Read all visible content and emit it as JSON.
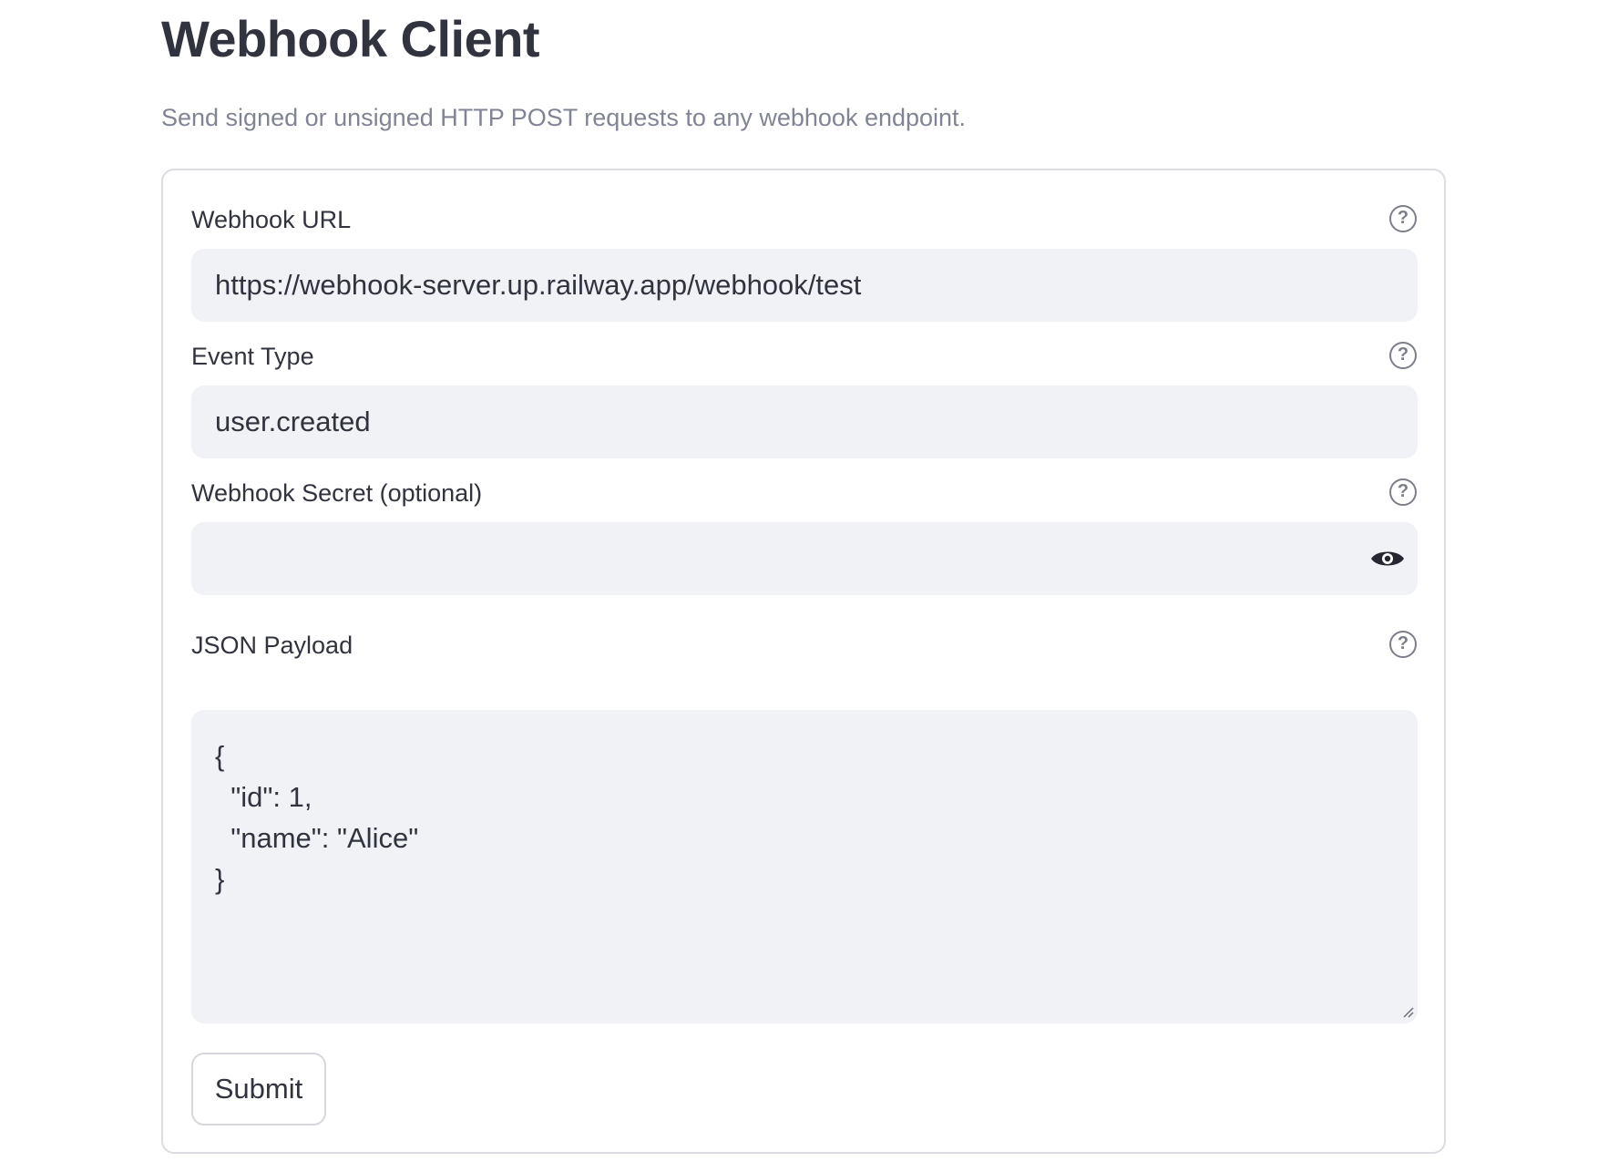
{
  "page": {
    "title": "Webhook Client",
    "subtitle": "Send signed or unsigned HTTP POST requests to any webhook endpoint."
  },
  "form": {
    "webhook_url": {
      "label": "Webhook URL",
      "value": "https://webhook-server.up.railway.app/webhook/test",
      "help_icon": "help-circle-icon"
    },
    "event_type": {
      "label": "Event Type",
      "value": "user.created",
      "help_icon": "help-circle-icon"
    },
    "webhook_secret": {
      "label": "Webhook Secret (optional)",
      "value": "",
      "help_icon": "help-circle-icon",
      "visibility_icon": "eye-icon"
    },
    "json_payload": {
      "label": "JSON Payload",
      "value": "{\n  \"id\": 1,\n  \"name\": \"Alice\"\n}",
      "help_icon": "help-circle-icon"
    },
    "submit_label": "Submit"
  },
  "colors": {
    "text": "#31333f",
    "muted_text": "#808495",
    "input_background": "#f0f2f6",
    "card_border": "#dcdde2",
    "icon": "#7c7f8a"
  }
}
